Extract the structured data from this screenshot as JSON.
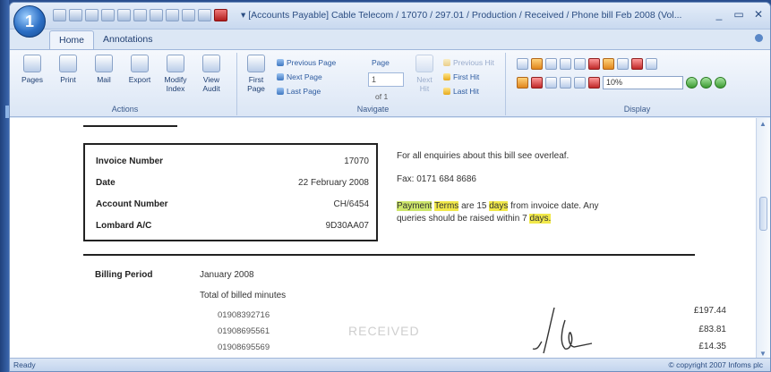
{
  "window": {
    "title": "▾ [Accounts Payable] Cable Telecom / 17070 / 297.01 / Production / Received / Phone bill Feb 2008 (Vol...",
    "app_button_label": "1",
    "controls": [
      "_",
      "▭",
      "✕"
    ]
  },
  "tabs": [
    "Home",
    "Annotations"
  ],
  "ribbon": {
    "actions": {
      "label": "Actions",
      "buttons": [
        "Pages",
        "Print",
        "Mail",
        "Export",
        "Modify Index",
        "View Audit"
      ]
    },
    "navigate": {
      "label": "Navigate",
      "first_page": "First Page",
      "previous_page": "Previous Page",
      "next_page": "Next Page",
      "last_page": "Last Page",
      "page_label": "Page",
      "page_value": "1",
      "page_of": "of 1",
      "next_hit": "Next Hit",
      "previous_hit": "Previous Hit",
      "first_hit": "First Hit",
      "last_hit": "Last Hit"
    },
    "display": {
      "label": "Display",
      "zoom": "10%"
    }
  },
  "document": {
    "invoice_box": [
      {
        "key": "Invoice Number",
        "value": "17070"
      },
      {
        "key": "Date",
        "value": "22 February 2008"
      },
      {
        "key": "Account Number",
        "value": "CH/6454"
      },
      {
        "key": "Lombard A/C",
        "value": "9D30AA07"
      }
    ],
    "enquiries_note": "For all enquiries about this bill see overleaf.",
    "fax_note": "Fax: 0171 684 8686",
    "payment_words": [
      "Payment",
      "Terms",
      "are 15",
      "days",
      "from invoice date. Any"
    ],
    "queries_words": [
      "queries should be raised within 7",
      "days."
    ],
    "billing_period_label": "Billing Period",
    "billing_period_value": "January 2008",
    "total_label": "Total of billed minutes",
    "phones": [
      "01908392716",
      "01908695561",
      "01908695569"
    ],
    "amounts": [
      "£197.44",
      "£83.81",
      "£14.35"
    ],
    "stamp": "RECEIVED"
  },
  "status": {
    "left": "Ready",
    "right": "© copyright 2007 Infoms plc"
  }
}
